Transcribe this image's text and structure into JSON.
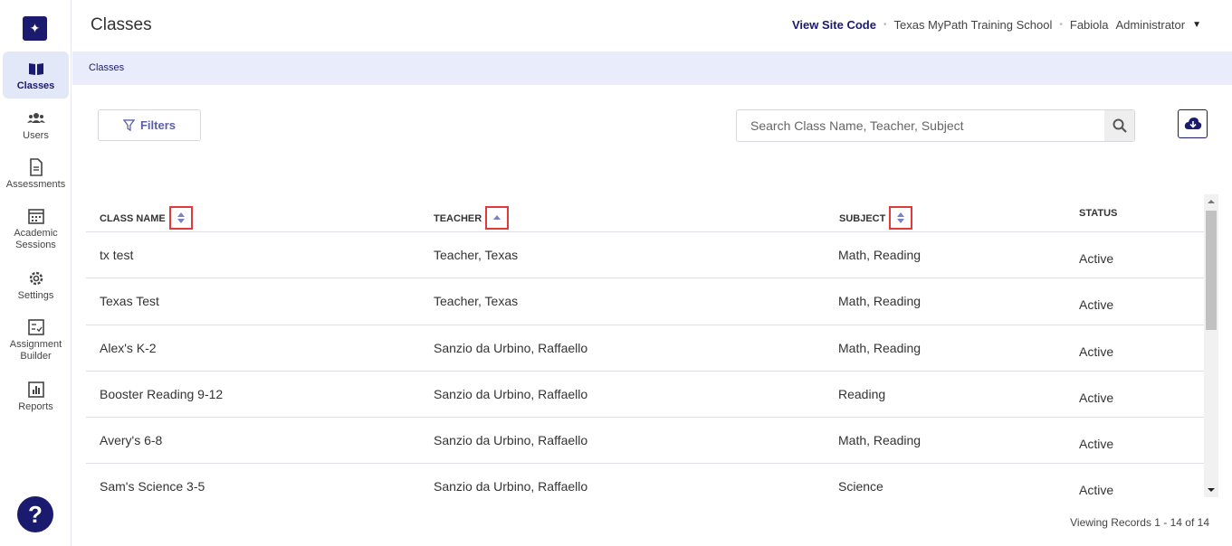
{
  "sidebar": {
    "items": [
      {
        "label": "Classes",
        "icon": "book-icon",
        "active": true
      },
      {
        "label": "Users",
        "icon": "users-icon"
      },
      {
        "label": "Assessments",
        "icon": "document-icon"
      },
      {
        "label": "Academic Sessions",
        "icon": "calendar-icon"
      },
      {
        "label": "Settings",
        "icon": "gear-icon"
      },
      {
        "label": "Assignment Builder",
        "icon": "checklist-icon"
      },
      {
        "label": "Reports",
        "icon": "bar-chart-icon"
      }
    ],
    "help_label": "?"
  },
  "header": {
    "title": "Classes",
    "site_code": "View Site Code",
    "school": "Texas MyPath Training School",
    "user_name": "Fabiola",
    "user_role": "Administrator"
  },
  "breadcrumb": "Classes",
  "toolbar": {
    "filters_label": "Filters",
    "search_placeholder": "Search Class Name, Teacher, Subject"
  },
  "table": {
    "columns": [
      "CLASS NAME",
      "TEACHER",
      "SUBJECT",
      "STATUS"
    ],
    "rows": [
      [
        "tx test",
        "Teacher, Texas",
        "Math, Reading",
        "Active"
      ],
      [
        "Texas Test",
        "Teacher, Texas",
        "Math, Reading",
        "Active"
      ],
      [
        "Alex's K-2",
        "Sanzio da Urbino, Raffaello",
        "Math, Reading",
        "Active"
      ],
      [
        "Booster Reading 9-12",
        "Sanzio da Urbino, Raffaello",
        "Reading",
        "Active"
      ],
      [
        "Avery's 6-8",
        "Sanzio da Urbino, Raffaello",
        "Math, Reading",
        "Active"
      ],
      [
        "Sam's Science 3-5",
        "Sanzio da Urbino, Raffaello",
        "Science",
        "Active"
      ]
    ]
  },
  "footer": {
    "records": "Viewing Records 1 - 14 of 14"
  },
  "colors": {
    "brand": "#1a1a6e",
    "highlight": "#e03a3a",
    "breadcrumb_bg": "#e9edfb"
  }
}
